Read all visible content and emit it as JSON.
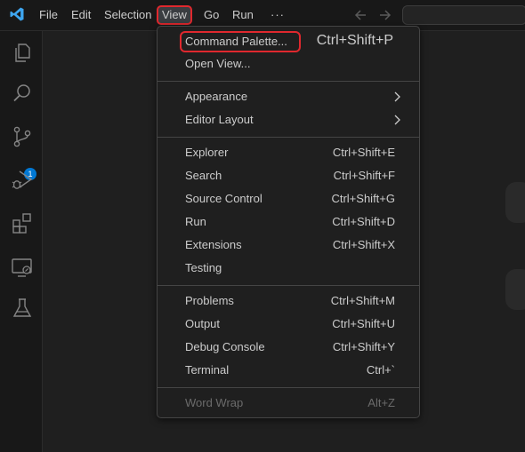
{
  "titlebar": {
    "menus": [
      "File",
      "Edit",
      "Selection",
      "View",
      "Go",
      "Run",
      "···"
    ],
    "active_menu": "View"
  },
  "activity_bar": {
    "icons": [
      "explorer-icon",
      "search-icon",
      "source-control-icon",
      "run-debug-icon",
      "extensions-icon",
      "remote-explorer-icon",
      "testing-icon"
    ],
    "source_control_badge": "1"
  },
  "view_menu": {
    "groups": [
      [
        {
          "label": "Command Palette...",
          "shortcut": "Ctrl+Shift+P"
        },
        {
          "label": "Open View...",
          "shortcut": ""
        }
      ],
      [
        {
          "label": "Appearance",
          "submenu": true
        },
        {
          "label": "Editor Layout",
          "submenu": true
        }
      ],
      [
        {
          "label": "Explorer",
          "shortcut": "Ctrl+Shift+E"
        },
        {
          "label": "Search",
          "shortcut": "Ctrl+Shift+F"
        },
        {
          "label": "Source Control",
          "shortcut": "Ctrl+Shift+G"
        },
        {
          "label": "Run",
          "shortcut": "Ctrl+Shift+D"
        },
        {
          "label": "Extensions",
          "shortcut": "Ctrl+Shift+X"
        },
        {
          "label": "Testing",
          "shortcut": ""
        }
      ],
      [
        {
          "label": "Problems",
          "shortcut": "Ctrl+Shift+M"
        },
        {
          "label": "Output",
          "shortcut": "Ctrl+Shift+U"
        },
        {
          "label": "Debug Console",
          "shortcut": "Ctrl+Shift+Y"
        },
        {
          "label": "Terminal",
          "shortcut": "Ctrl+`"
        }
      ],
      [
        {
          "label": "Word Wrap",
          "shortcut": "Alt+Z",
          "disabled": true
        }
      ]
    ]
  },
  "colors": {
    "highlight_border": "#e0282e",
    "badge": "#0078d4",
    "logo": "#3ea6f0"
  }
}
